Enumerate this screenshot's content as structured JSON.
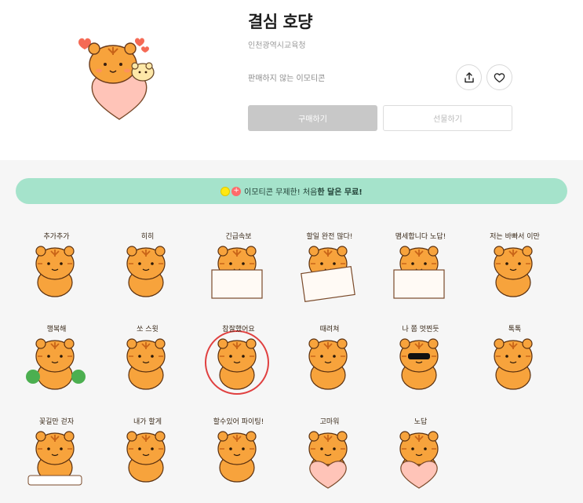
{
  "product": {
    "title": "결심 호댱",
    "publisher": "인천광역시교육청",
    "sale_status": "판매하지 않는 이모티콘"
  },
  "actions": {
    "share_icon": "share-icon",
    "like_icon": "heart-icon",
    "buy_label": "구매하기",
    "gift_label": "선물하기"
  },
  "promo": {
    "text_prefix": "이모티콘 무제한! 처음 ",
    "text_bold": "한 달은 무료!"
  },
  "stickers": [
    {
      "caption": "추가추가"
    },
    {
      "caption": "히히"
    },
    {
      "caption": "긴급속보"
    },
    {
      "caption": "할일 완전 많다!"
    },
    {
      "caption": "맴세합니다 노답!"
    },
    {
      "caption": "저는 바빠서 이만"
    },
    {
      "caption": "행복해"
    },
    {
      "caption": "쏘 스윗"
    },
    {
      "caption": "참잘했어요"
    },
    {
      "caption": "때려쳐"
    },
    {
      "caption": "나 쫌 멋찐듯"
    },
    {
      "caption": "톡톡"
    },
    {
      "caption": "꽃길만 걷자"
    },
    {
      "caption": "내가 할게"
    },
    {
      "caption": "할수있어 파이팅!"
    },
    {
      "caption": "고마워"
    },
    {
      "caption": "노답"
    }
  ],
  "colors": {
    "tiger": "#f7a33c",
    "stripe": "#c86418",
    "promo_bg": "#a5e3cb",
    "buy_bg": "#c8c8c8",
    "heart": "#ffc4b8"
  }
}
